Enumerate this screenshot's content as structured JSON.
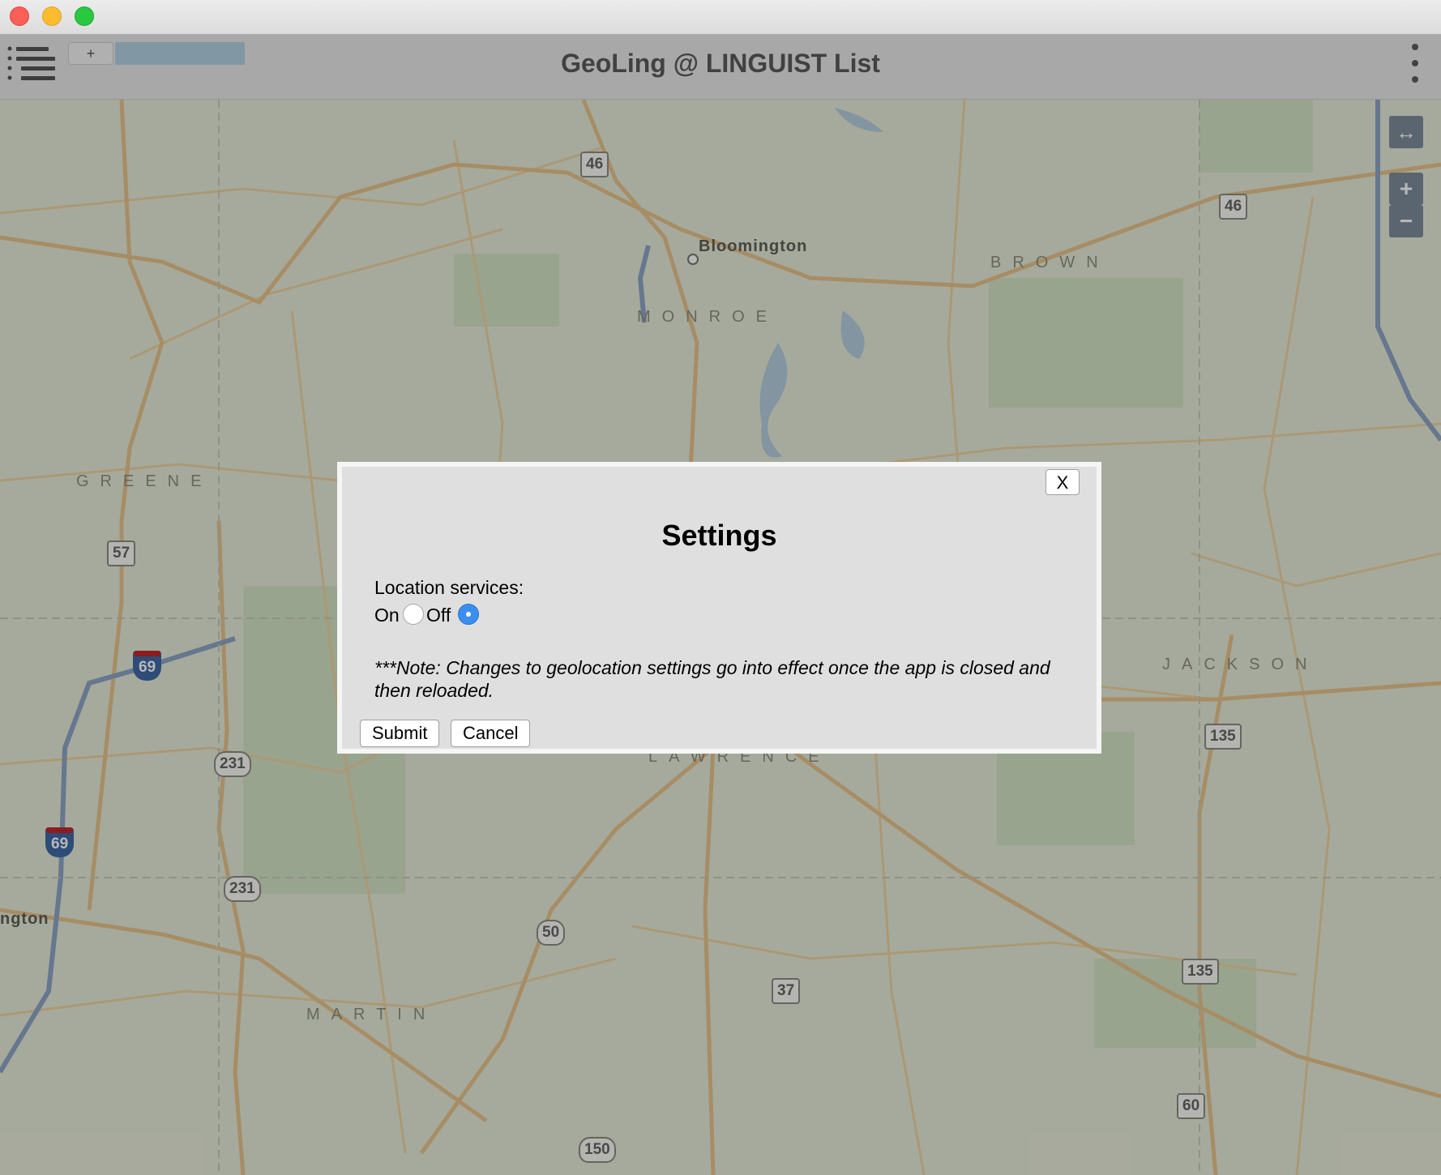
{
  "window": {
    "title": ""
  },
  "header": {
    "title": "GeoLing @ LINGUIST List",
    "add_tab_label": "+",
    "menu_icon": "hamburger-list-icon",
    "more_icon": "vertical-ellipsis-icon"
  },
  "map": {
    "controls": {
      "expand": "↔",
      "zoom_in": "+",
      "zoom_out": "−"
    },
    "city_labels": [
      "Bloomington",
      "ngton"
    ],
    "county_labels": [
      "GREENE",
      "MONROE",
      "BROWN",
      "JACKSON",
      "LAWRENCE",
      "MARTIN"
    ],
    "route_shields": {
      "state": [
        "46",
        "46",
        "57",
        "37",
        "135",
        "135",
        "60"
      ],
      "us": [
        "231",
        "231",
        "50",
        "150"
      ],
      "interstate": [
        "69",
        "69"
      ]
    }
  },
  "dialog": {
    "close_label": "X",
    "title": "Settings",
    "location_label": "Location services:",
    "option_on": "On",
    "option_off": "Off",
    "selected": "Off",
    "note": "***Note: Changes to geolocation settings go into effect once the app is closed and then reloaded.",
    "submit_label": "Submit",
    "cancel_label": "Cancel"
  },
  "colors": {
    "overlay": "#000000",
    "radio_selected": "#3b8ef0",
    "map_background": "#e7ecd8",
    "map_controls": "#7d8c9b"
  }
}
